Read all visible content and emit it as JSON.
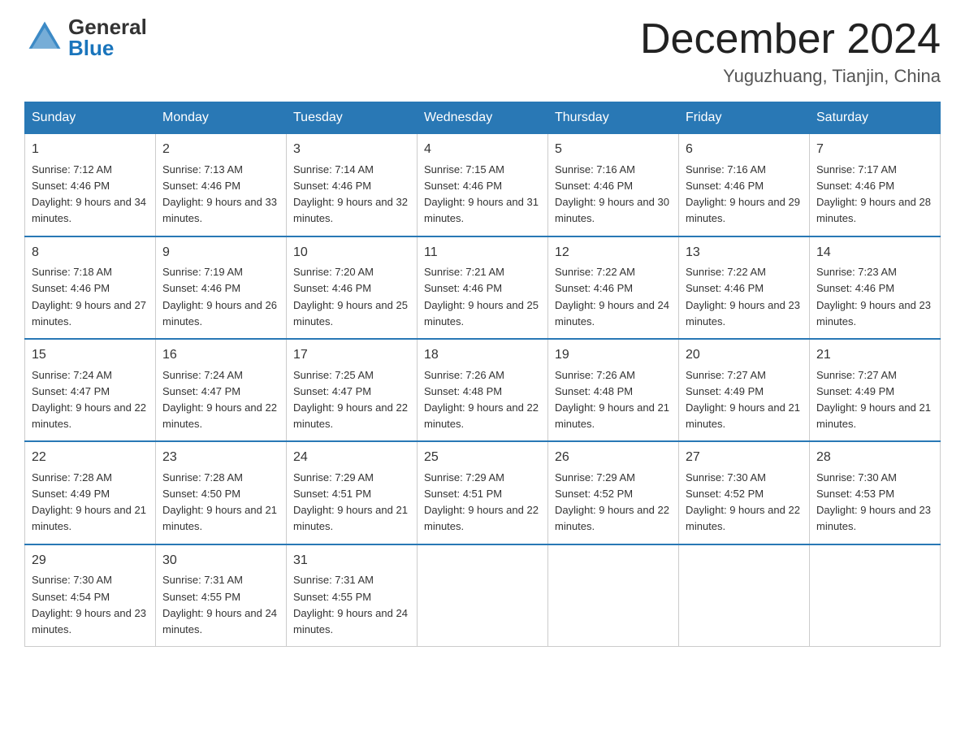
{
  "header": {
    "month_title": "December 2024",
    "location": "Yuguzhuang, Tianjin, China",
    "logo_general": "General",
    "logo_blue": "Blue"
  },
  "days_of_week": [
    "Sunday",
    "Monday",
    "Tuesday",
    "Wednesday",
    "Thursday",
    "Friday",
    "Saturday"
  ],
  "weeks": [
    [
      {
        "day": "1",
        "sunrise": "7:12 AM",
        "sunset": "4:46 PM",
        "daylight": "9 hours and 34 minutes."
      },
      {
        "day": "2",
        "sunrise": "7:13 AM",
        "sunset": "4:46 PM",
        "daylight": "9 hours and 33 minutes."
      },
      {
        "day": "3",
        "sunrise": "7:14 AM",
        "sunset": "4:46 PM",
        "daylight": "9 hours and 32 minutes."
      },
      {
        "day": "4",
        "sunrise": "7:15 AM",
        "sunset": "4:46 PM",
        "daylight": "9 hours and 31 minutes."
      },
      {
        "day": "5",
        "sunrise": "7:16 AM",
        "sunset": "4:46 PM",
        "daylight": "9 hours and 30 minutes."
      },
      {
        "day": "6",
        "sunrise": "7:16 AM",
        "sunset": "4:46 PM",
        "daylight": "9 hours and 29 minutes."
      },
      {
        "day": "7",
        "sunrise": "7:17 AM",
        "sunset": "4:46 PM",
        "daylight": "9 hours and 28 minutes."
      }
    ],
    [
      {
        "day": "8",
        "sunrise": "7:18 AM",
        "sunset": "4:46 PM",
        "daylight": "9 hours and 27 minutes."
      },
      {
        "day": "9",
        "sunrise": "7:19 AM",
        "sunset": "4:46 PM",
        "daylight": "9 hours and 26 minutes."
      },
      {
        "day": "10",
        "sunrise": "7:20 AM",
        "sunset": "4:46 PM",
        "daylight": "9 hours and 25 minutes."
      },
      {
        "day": "11",
        "sunrise": "7:21 AM",
        "sunset": "4:46 PM",
        "daylight": "9 hours and 25 minutes."
      },
      {
        "day": "12",
        "sunrise": "7:22 AM",
        "sunset": "4:46 PM",
        "daylight": "9 hours and 24 minutes."
      },
      {
        "day": "13",
        "sunrise": "7:22 AM",
        "sunset": "4:46 PM",
        "daylight": "9 hours and 23 minutes."
      },
      {
        "day": "14",
        "sunrise": "7:23 AM",
        "sunset": "4:46 PM",
        "daylight": "9 hours and 23 minutes."
      }
    ],
    [
      {
        "day": "15",
        "sunrise": "7:24 AM",
        "sunset": "4:47 PM",
        "daylight": "9 hours and 22 minutes."
      },
      {
        "day": "16",
        "sunrise": "7:24 AM",
        "sunset": "4:47 PM",
        "daylight": "9 hours and 22 minutes."
      },
      {
        "day": "17",
        "sunrise": "7:25 AM",
        "sunset": "4:47 PM",
        "daylight": "9 hours and 22 minutes."
      },
      {
        "day": "18",
        "sunrise": "7:26 AM",
        "sunset": "4:48 PM",
        "daylight": "9 hours and 22 minutes."
      },
      {
        "day": "19",
        "sunrise": "7:26 AM",
        "sunset": "4:48 PM",
        "daylight": "9 hours and 21 minutes."
      },
      {
        "day": "20",
        "sunrise": "7:27 AM",
        "sunset": "4:49 PM",
        "daylight": "9 hours and 21 minutes."
      },
      {
        "day": "21",
        "sunrise": "7:27 AM",
        "sunset": "4:49 PM",
        "daylight": "9 hours and 21 minutes."
      }
    ],
    [
      {
        "day": "22",
        "sunrise": "7:28 AM",
        "sunset": "4:49 PM",
        "daylight": "9 hours and 21 minutes."
      },
      {
        "day": "23",
        "sunrise": "7:28 AM",
        "sunset": "4:50 PM",
        "daylight": "9 hours and 21 minutes."
      },
      {
        "day": "24",
        "sunrise": "7:29 AM",
        "sunset": "4:51 PM",
        "daylight": "9 hours and 21 minutes."
      },
      {
        "day": "25",
        "sunrise": "7:29 AM",
        "sunset": "4:51 PM",
        "daylight": "9 hours and 22 minutes."
      },
      {
        "day": "26",
        "sunrise": "7:29 AM",
        "sunset": "4:52 PM",
        "daylight": "9 hours and 22 minutes."
      },
      {
        "day": "27",
        "sunrise": "7:30 AM",
        "sunset": "4:52 PM",
        "daylight": "9 hours and 22 minutes."
      },
      {
        "day": "28",
        "sunrise": "7:30 AM",
        "sunset": "4:53 PM",
        "daylight": "9 hours and 23 minutes."
      }
    ],
    [
      {
        "day": "29",
        "sunrise": "7:30 AM",
        "sunset": "4:54 PM",
        "daylight": "9 hours and 23 minutes."
      },
      {
        "day": "30",
        "sunrise": "7:31 AM",
        "sunset": "4:55 PM",
        "daylight": "9 hours and 24 minutes."
      },
      {
        "day": "31",
        "sunrise": "7:31 AM",
        "sunset": "4:55 PM",
        "daylight": "9 hours and 24 minutes."
      },
      null,
      null,
      null,
      null
    ]
  ],
  "labels": {
    "sunrise": "Sunrise:",
    "sunset": "Sunset:",
    "daylight": "Daylight:"
  },
  "colors": {
    "header_bg": "#2978b5",
    "header_text": "#ffffff",
    "border": "#2978b5",
    "cell_border": "#cccccc",
    "text": "#333333"
  }
}
